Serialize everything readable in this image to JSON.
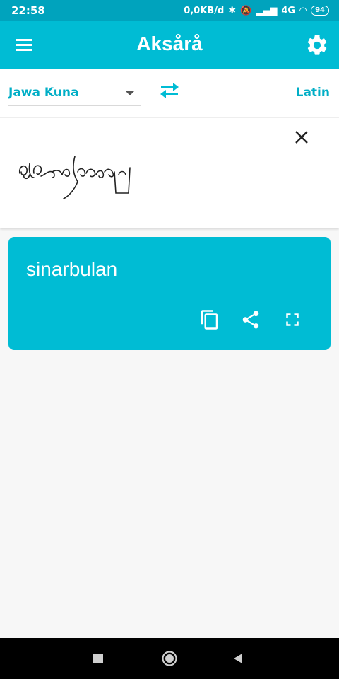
{
  "status_bar": {
    "time": "22:58",
    "net_speed": "0,0KB/d",
    "network": "4G",
    "battery": "94"
  },
  "app_bar": {
    "title": "Aksårå",
    "color": "#00bcd4"
  },
  "languages": {
    "source": "Jawa Kuna",
    "target": "Latin",
    "accent_color": "#00aec6"
  },
  "input": {
    "script_icon": "javanese-script-handwriting"
  },
  "result": {
    "text": "sinarbulan"
  },
  "icons": {
    "menu": "hamburger-menu-icon",
    "settings": "gear-icon",
    "swap": "swap-arrows-icon",
    "clear": "close-icon",
    "copy": "copy-icon",
    "share": "share-icon",
    "fullscreen": "fullscreen-icon"
  }
}
